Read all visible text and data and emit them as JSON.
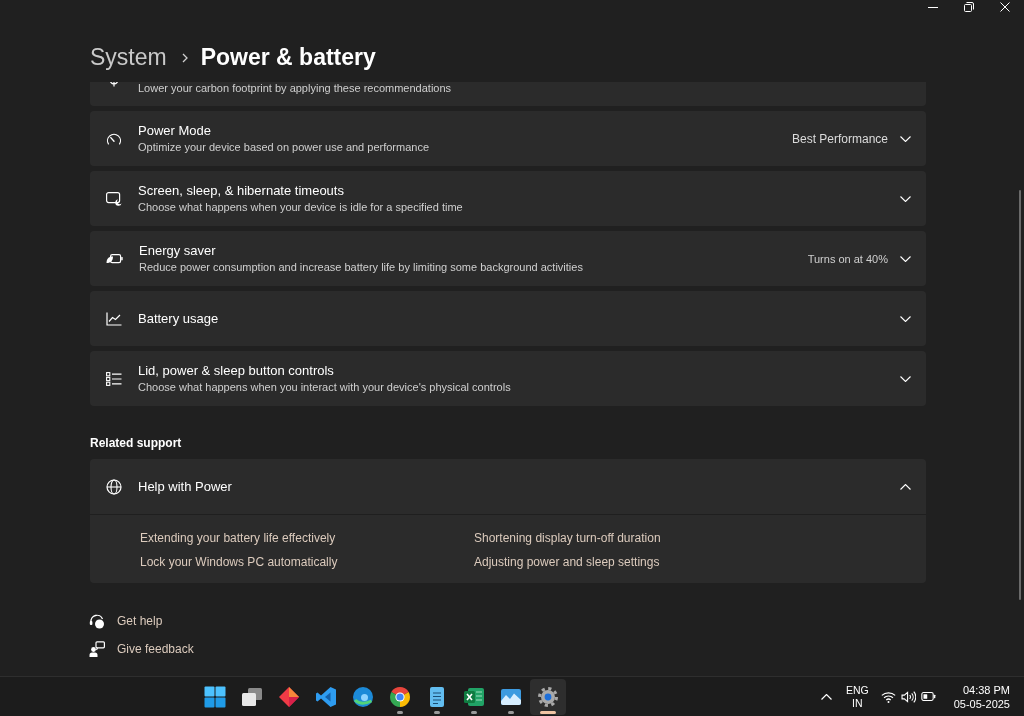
{
  "breadcrumb": {
    "parent": "System",
    "current": "Power & battery"
  },
  "partial_card": {
    "description": "Lower your carbon footprint by applying these recommendations"
  },
  "settings": [
    {
      "title": "Power Mode",
      "description": "Optimize your device based on power use and performance",
      "value": "Best Performance",
      "expanded": false
    },
    {
      "title": "Screen, sleep, & hibernate timeouts",
      "description": "Choose what happens when your device is idle for a specified time",
      "expanded": false
    },
    {
      "title": "Energy saver",
      "description": "Reduce power consumption and increase battery life by limiting some background activities",
      "status": "Turns on at 40%",
      "expanded": false
    },
    {
      "title": "Battery usage",
      "expanded": false
    },
    {
      "title": "Lid, power & sleep button controls",
      "description": "Choose what happens when you interact with your device's physical controls",
      "expanded": false
    }
  ],
  "related_support": {
    "heading": "Related support",
    "help": {
      "title": "Help with Power",
      "expanded": true,
      "links": [
        "Extending your battery life effectively",
        "Shortening display turn-off duration",
        "Lock your Windows PC automatically",
        "Adjusting power and sleep settings"
      ]
    }
  },
  "footer_links": [
    "Get help",
    "Give feedback"
  ],
  "taskbar": {
    "apps": [
      {
        "running": false,
        "selected": false
      },
      {
        "running": false,
        "selected": false
      },
      {
        "running": false,
        "selected": false
      },
      {
        "running": false,
        "selected": false
      },
      {
        "running": false,
        "selected": false
      },
      {
        "running": true,
        "selected": false
      },
      {
        "running": true,
        "selected": false
      },
      {
        "running": true,
        "selected": false
      },
      {
        "running": true,
        "selected": false
      },
      {
        "running": true,
        "selected": true
      }
    ],
    "tray": {
      "language": "ENG",
      "region": "IN",
      "time": "04:38 PM",
      "date": "05-05-2025"
    }
  }
}
